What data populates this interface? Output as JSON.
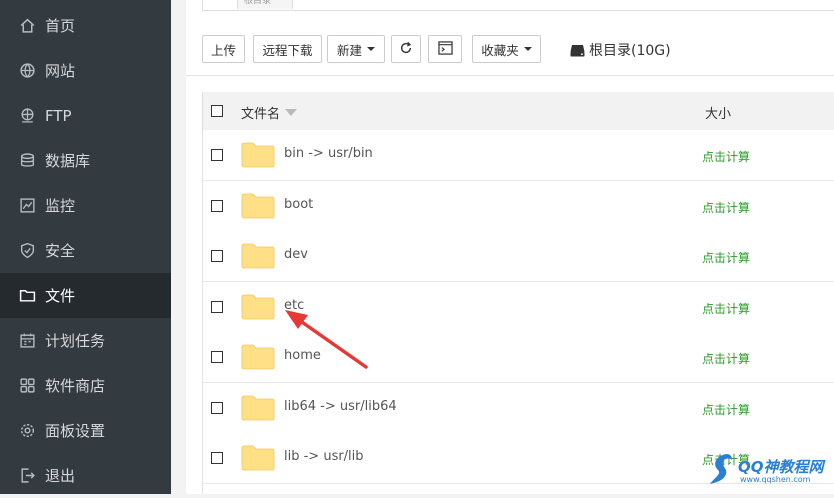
{
  "sidebar": {
    "items": [
      {
        "label": "首页",
        "icon": "home-icon",
        "active": false
      },
      {
        "label": "网站",
        "icon": "globe-icon",
        "active": false
      },
      {
        "label": "FTP",
        "icon": "ftp-icon",
        "active": false
      },
      {
        "label": "数据库",
        "icon": "database-icon",
        "active": false
      },
      {
        "label": "监控",
        "icon": "monitor-icon",
        "active": false
      },
      {
        "label": "安全",
        "icon": "shield-icon",
        "active": false
      },
      {
        "label": "文件",
        "icon": "folder-icon",
        "active": true
      },
      {
        "label": "计划任务",
        "icon": "calendar-icon",
        "active": false
      },
      {
        "label": "软件商店",
        "icon": "grid-icon",
        "active": false
      },
      {
        "label": "面板设置",
        "icon": "gear-icon",
        "active": false
      },
      {
        "label": "退出",
        "icon": "logout-icon",
        "active": false
      }
    ]
  },
  "breadcrumb": {
    "root_label": "根目录"
  },
  "toolbar": {
    "upload": "上传",
    "remote_download": "远程下载",
    "new": "新建",
    "refresh_icon": "refresh-icon",
    "terminal_icon": "terminal-icon",
    "favorites": "收藏夹",
    "disk_label": "根目录(10G)"
  },
  "table": {
    "col_name": "文件名",
    "col_size": "大小",
    "rows": [
      {
        "name": "bin -> usr/bin",
        "size": "点击计算"
      },
      {
        "name": "boot",
        "size": "点击计算"
      },
      {
        "name": "dev",
        "size": "点击计算"
      },
      {
        "name": "etc",
        "size": "点击计算"
      },
      {
        "name": "home",
        "size": "点击计算"
      },
      {
        "name": "lib64 -> usr/lib64",
        "size": "点击计算"
      },
      {
        "name": "lib -> usr/lib",
        "size": "点击计算"
      }
    ]
  },
  "colors": {
    "sidebar_bg": "#333b41",
    "sidebar_active": "#252a2f",
    "size_link": "#2c9a2c",
    "annotation_arrow": "#e53935",
    "folder": "#ffe086"
  },
  "watermark": {
    "title": "QQ神教程网",
    "url": "www.qqshen.com"
  }
}
